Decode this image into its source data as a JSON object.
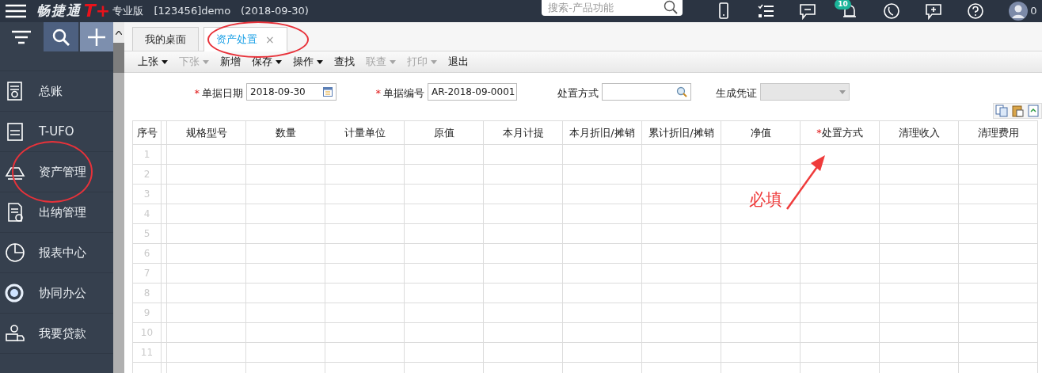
{
  "header": {
    "logo": "畅捷通",
    "logo_mark": "T+",
    "edition": "专业版",
    "account": "[123456]demo",
    "date": "(2018-09-30)",
    "search": {
      "placeholder": "搜索-产品功能"
    },
    "notification_badge": "10",
    "user_text": "0"
  },
  "sidebar": {
    "items": [
      {
        "label": "总账"
      },
      {
        "label": "T-UFO"
      },
      {
        "label": "资产管理"
      },
      {
        "label": "出纳管理"
      },
      {
        "label": "报表中心"
      },
      {
        "label": "协同办公"
      },
      {
        "label": "我要贷款"
      }
    ]
  },
  "tabs": [
    {
      "label": "我的桌面",
      "selected": false
    },
    {
      "label": "资产处置",
      "selected": true,
      "close_symbol": "×"
    }
  ],
  "toolbar": [
    {
      "label": "上张",
      "dropdown": true,
      "disabled": false
    },
    {
      "label": "下张",
      "dropdown": true,
      "disabled": true
    },
    {
      "label": "新增",
      "dropdown": false,
      "disabled": false
    },
    {
      "label": "保存",
      "dropdown": true,
      "disabled": false
    },
    {
      "label": "操作",
      "dropdown": true,
      "disabled": false
    },
    {
      "label": "查找",
      "dropdown": false,
      "disabled": false
    },
    {
      "label": "联查",
      "dropdown": true,
      "disabled": true
    },
    {
      "label": "打印",
      "dropdown": true,
      "disabled": true
    },
    {
      "label": "退出",
      "dropdown": false,
      "disabled": false
    }
  ],
  "form": {
    "fields": [
      {
        "marker": "*",
        "label": "单据日期",
        "kind": "date",
        "value": "2018-09-30",
        "disabled": false
      },
      {
        "marker": "*",
        "label": "单据编号",
        "kind": "text",
        "value": "AR-2018-09-0001",
        "disabled": false
      },
      {
        "label": "处置方式",
        "kind": "lookup",
        "disabled": false
      },
      {
        "label": "生成凭证",
        "kind": "select",
        "disabled": true
      }
    ]
  },
  "table": {
    "columns": [
      {
        "label": "序号"
      },
      {
        "label": "规格型号"
      },
      {
        "label": "数量"
      },
      {
        "label": "计量单位"
      },
      {
        "label": "原值"
      },
      {
        "label": "本月计提"
      },
      {
        "label": "本月折旧/摊销"
      },
      {
        "label": "累计折旧/摊销"
      },
      {
        "label": "净值"
      },
      {
        "marker": "*",
        "label": "处置方式"
      },
      {
        "label": "清理收入"
      },
      {
        "label": "清理费用"
      }
    ],
    "rows": [
      "1",
      "2",
      "3",
      "4",
      "5",
      "6",
      "7",
      "8",
      "9",
      "10",
      "11"
    ]
  },
  "annotations": [
    {
      "kind": "ellipse"
    },
    {
      "kind": "ellipse"
    },
    {
      "kind": "arrow",
      "text": "必填"
    }
  ]
}
